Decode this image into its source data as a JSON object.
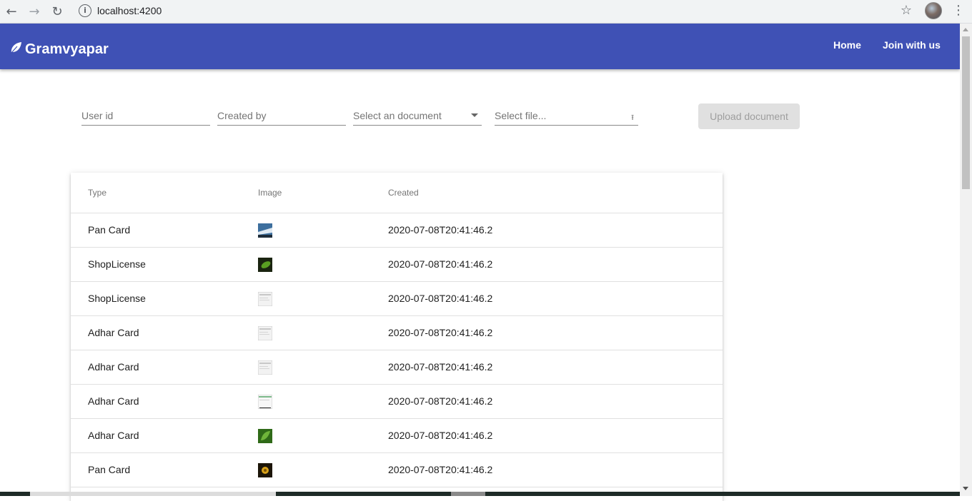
{
  "browser": {
    "url": "localhost:4200"
  },
  "app": {
    "brand": "Gramvyapar",
    "nav": [
      {
        "label": "Home"
      },
      {
        "label": "Join with us"
      }
    ],
    "colors": {
      "primary": "#3f51b5"
    }
  },
  "form": {
    "user_id_placeholder": "User id",
    "created_by_placeholder": "Created by",
    "select_document_label": "Select an document",
    "select_file_label": "Select file...",
    "upload_button_label": "Upload document"
  },
  "table": {
    "headers": [
      "Type",
      "Image",
      "Created"
    ],
    "rows": [
      {
        "type": "Pan Card",
        "created": "2020-07-08T20:41:46.2",
        "thumb": "sky-photo"
      },
      {
        "type": "ShopLicense",
        "created": "2020-07-08T20:41:46.2",
        "thumb": "green-object-photo"
      },
      {
        "type": "ShopLicense",
        "created": "2020-07-08T20:41:46.2",
        "thumb": "document-screenshot"
      },
      {
        "type": "Adhar Card",
        "created": "2020-07-08T20:41:46.2",
        "thumb": "document-screenshot"
      },
      {
        "type": "Adhar Card",
        "created": "2020-07-08T20:41:46.2",
        "thumb": "document-screenshot"
      },
      {
        "type": "Adhar Card",
        "created": "2020-07-08T20:41:46.2",
        "thumb": "spreadsheet-screenshot"
      },
      {
        "type": "Adhar Card",
        "created": "2020-07-08T20:41:46.2",
        "thumb": "leaf-photo"
      },
      {
        "type": "Pan Card",
        "created": "2020-07-08T20:41:46.2",
        "thumb": "flower-photo"
      }
    ]
  }
}
